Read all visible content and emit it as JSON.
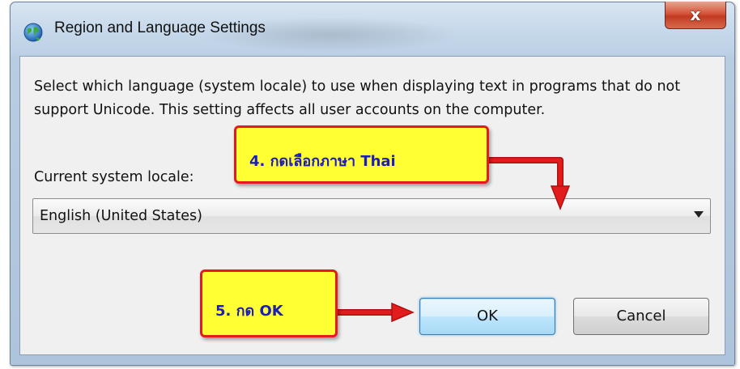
{
  "window": {
    "title": "Region and Language Settings",
    "close_glyph": "x"
  },
  "dialog": {
    "description": "Select which language (system locale) to use when displaying text in programs that do not support Unicode. This setting affects all user accounts on the computer.",
    "locale_label": "Current system locale:",
    "locale_select": {
      "selected": "English (United States)"
    },
    "buttons": {
      "ok": "OK",
      "cancel": "Cancel"
    }
  },
  "annotations": [
    {
      "id": "step4",
      "text": "4. กดเลือกภาษา Thai"
    },
    {
      "id": "step5",
      "text": "5. กด OK"
    }
  ],
  "colors": {
    "callout_fill": "#ffff33",
    "callout_border": "#e21c1c",
    "callout_text": "#1d1db8",
    "arrow": "#e21c1c"
  },
  "icons": [
    "globe-icon",
    "close-icon",
    "chevron-down-icon",
    "arrow-icon"
  ]
}
